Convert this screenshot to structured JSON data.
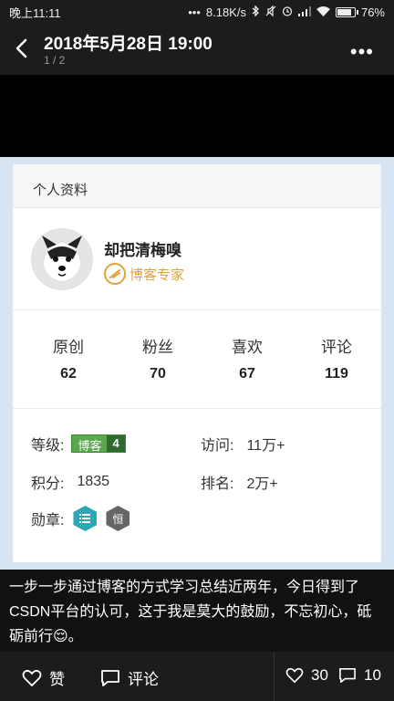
{
  "status": {
    "time": "晚上11:11",
    "dots": "•••",
    "speed": "8.18K/s",
    "battery": "76%"
  },
  "header": {
    "title": "2018年5月28日 19:00",
    "pager": "1 / 2",
    "more": "•••"
  },
  "card": {
    "heading": "个人资料",
    "username": "却把清梅嗅",
    "expert_badge": "博客专家",
    "stats": [
      {
        "label": "原创",
        "value": "62"
      },
      {
        "label": "粉丝",
        "value": "70"
      },
      {
        "label": "喜欢",
        "value": "67"
      },
      {
        "label": "评论",
        "value": "119"
      }
    ],
    "level_label": "等级:",
    "level_badge_text": "博客",
    "level_badge_num": "4",
    "visits_label": "访问:",
    "visits_value": "11万+",
    "points_label": "积分:",
    "points_value": "1835",
    "rank_label": "排名:",
    "rank_value": "2万+",
    "medal_label": "勋章:",
    "medal2_text": "恒"
  },
  "caption": "一步一步通过博客的方式学习总结近两年，今日得到了CSDN平台的认可，这于我是莫大的鼓励，不忘初心，砥砺前行😌。",
  "bottom": {
    "like_label": "赞",
    "comment_label": "评论",
    "like_count": "30",
    "comment_count": "10"
  }
}
